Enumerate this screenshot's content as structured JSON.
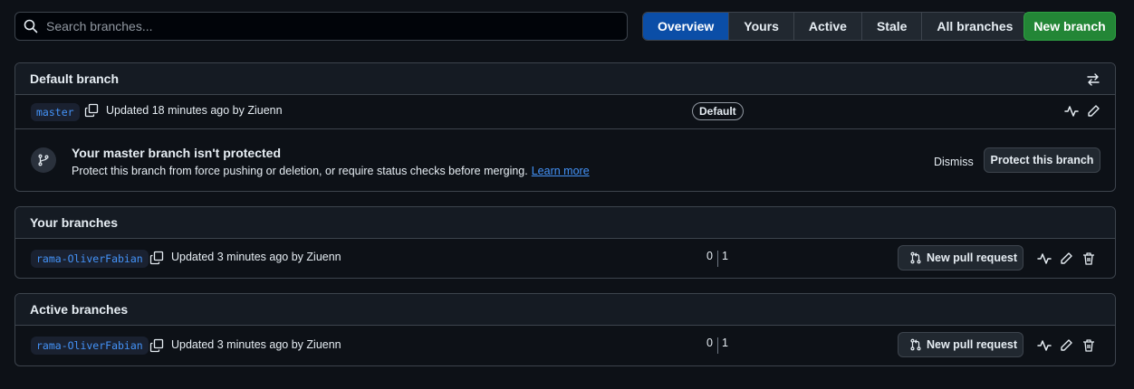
{
  "search": {
    "placeholder": "Search branches..."
  },
  "tabs": [
    {
      "label": "Overview",
      "active": true
    },
    {
      "label": "Yours",
      "active": false
    },
    {
      "label": "Active",
      "active": false
    },
    {
      "label": "Stale",
      "active": false
    },
    {
      "label": "All branches",
      "active": false
    }
  ],
  "new_branch_label": "New branch",
  "default_section": {
    "title": "Default branch",
    "branch": "master",
    "updated": "Updated 18 minutes ago by Ziuenn",
    "badge": "Default",
    "protect_title": "Your master branch isn't protected",
    "protect_desc": "Protect this branch from force pushing or deletion, or require status checks before merging.",
    "learn_more": "Learn more",
    "dismiss": "Dismiss",
    "protect_button": "Protect this branch"
  },
  "your_section": {
    "title": "Your branches",
    "branch": "rama-OliverFabian",
    "updated": "Updated 3 minutes ago by Ziuenn",
    "behind": "0",
    "ahead": "1",
    "pr_button": "New pull request"
  },
  "active_section": {
    "title": "Active branches",
    "branch": "rama-OliverFabian",
    "updated": "Updated 3 minutes ago by Ziuenn",
    "behind": "0",
    "ahead": "1",
    "pr_button": "New pull request"
  },
  "colors": {
    "accent": "#0b4ea7",
    "primary_button": "#238636",
    "link": "#4493f8",
    "background": "#0d1117"
  }
}
